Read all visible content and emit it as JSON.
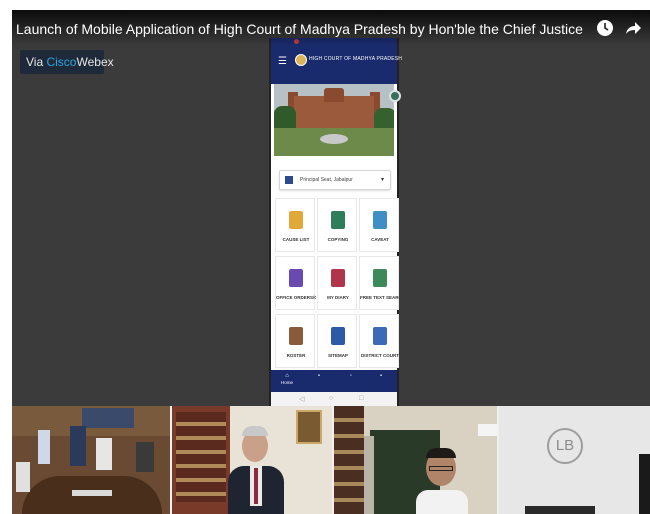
{
  "video": {
    "title": "Launch of Mobile Application of High Court of Madhya Pradesh by Hon'ble the Chief Justice",
    "icons": [
      "clock-icon",
      "share-arrow-icon"
    ]
  },
  "webex_badge": {
    "via": "Via ",
    "cisco": "Cisco",
    "webex": "Webex"
  },
  "app": {
    "header_title": "HIGH COURT OF MADHYA PRADESH",
    "bench": "Principal Seat, Jabalpur",
    "tiles": [
      {
        "label": "CAUSE LIST",
        "icon": "cause-list-icon",
        "color": "#e0a93a"
      },
      {
        "label": "COPYING",
        "icon": "copying-icon",
        "color": "#2e7d5b"
      },
      {
        "label": "CAVEAT",
        "icon": "caveat-icon",
        "color": "#3d8fc4"
      },
      {
        "label": "OFFICE ORDERS/CIRCULARS",
        "icon": "office-orders-icon",
        "color": "#6a4ab0"
      },
      {
        "label": "MY DIARY",
        "icon": "my-diary-icon",
        "color": "#b0344a"
      },
      {
        "label": "FREE TEXT SEARCH",
        "icon": "free-text-search-icon",
        "color": "#3c8a5a"
      },
      {
        "label": "ROSTER",
        "icon": "roster-icon",
        "color": "#8a5a3c"
      },
      {
        "label": "SITEMAP",
        "icon": "sitemap-icon",
        "color": "#2d5aa8"
      },
      {
        "label": "DISTRICT COURT",
        "icon": "district-court-icon",
        "color": "#3a6ab8"
      }
    ],
    "bottom_nav": {
      "home_label": "Home"
    }
  },
  "participants": {
    "initials": "LB"
  }
}
